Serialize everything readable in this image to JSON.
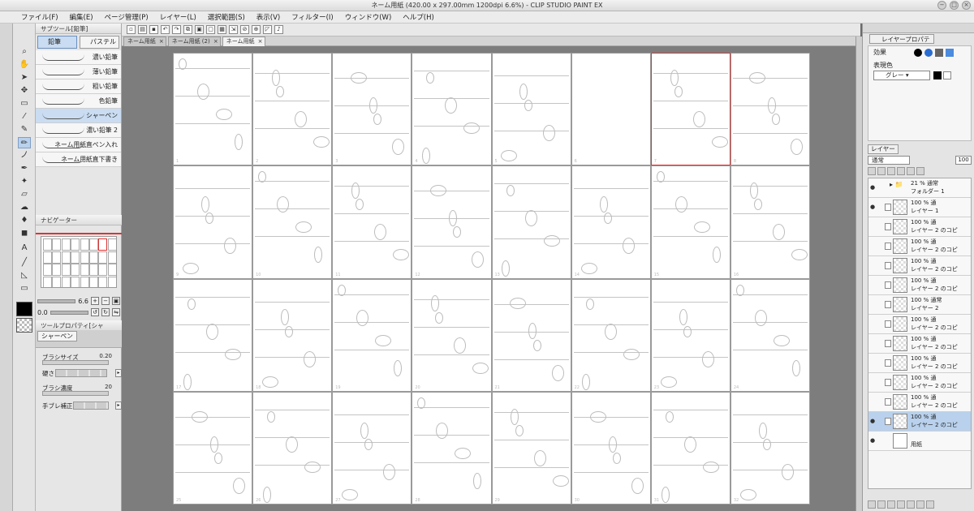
{
  "window": {
    "title": "ネーム用紙 (420.00 x 297.00mm 1200dpi 6.6%) - CLIP STUDIO PAINT EX",
    "minimize": "−",
    "maximize": "□",
    "close": "×"
  },
  "menu": [
    "ファイル(F)",
    "編集(E)",
    "ページ管理(P)",
    "レイヤー(L)",
    "選択範囲(S)",
    "表示(V)",
    "フィルター(I)",
    "ウィンドウ(W)",
    "ヘルプ(H)"
  ],
  "subtool": {
    "header": "サブツール[鉛筆]",
    "tabs": [
      "鉛筆",
      "パステル"
    ],
    "items": [
      "濃い鉛筆",
      "薄い鉛筆",
      "粗い鉛筆",
      "色鉛筆",
      "シャーペン",
      "濃い鉛筆 2",
      "ネーム用紙直ペン入れ",
      "ネーム用紙直下書き"
    ],
    "selected_index": 4
  },
  "navigator": {
    "header": "ナビゲーター",
    "zoom": "6.6",
    "rotation": "0.0"
  },
  "tool_property": {
    "header": "ツールプロパティ[シャ",
    "tool_name": "シャーペン",
    "brush_size_label": "ブラシサイズ",
    "brush_size_value": "0.20",
    "hardness_label": "硬さ",
    "density_label": "ブラシ濃度",
    "density_value": "20",
    "stabilization_label": "手ブレ補正"
  },
  "doc_tabs": [
    "ネーム用紙",
    "ネーム用紙 (2)",
    "ネーム用紙"
  ],
  "page_numbers": [
    "1",
    "2",
    "3",
    "4",
    "5",
    "6",
    "7",
    "8",
    "9",
    "10",
    "11",
    "12",
    "13",
    "14",
    "15",
    "16",
    "17",
    "18",
    "19",
    "20",
    "21",
    "22",
    "23",
    "24",
    "25",
    "26",
    "27",
    "28",
    "29",
    "30",
    "31",
    "32"
  ],
  "layer_property": {
    "header": "レイヤープロパティ",
    "effect_label": "効果",
    "color_label": "表現色",
    "color_value": "グレー"
  },
  "layers_panel": {
    "tab": "レイヤー",
    "blend_mode": "通常",
    "opacity": "100",
    "layers": [
      {
        "top": "21 % 通常",
        "name": "フォルダー 1",
        "type": "folder"
      },
      {
        "top": "100 % 通",
        "name": "レイヤー 1",
        "type": "raster"
      },
      {
        "top": "100 % 通",
        "name": "レイヤー 2 のコピ",
        "type": "raster"
      },
      {
        "top": "100 % 通",
        "name": "レイヤー 2 のコピ",
        "type": "raster"
      },
      {
        "top": "100 % 通",
        "name": "レイヤー 2 のコピ",
        "type": "raster"
      },
      {
        "top": "100 % 通",
        "name": "レイヤー 2 のコピ",
        "type": "raster"
      },
      {
        "top": "100 % 通常",
        "name": "レイヤー 2",
        "type": "raster"
      },
      {
        "top": "100 % 通",
        "name": "レイヤー 2 のコピ",
        "type": "raster"
      },
      {
        "top": "100 % 通",
        "name": "レイヤー 2 のコピ",
        "type": "raster"
      },
      {
        "top": "100 % 通",
        "name": "レイヤー 2 のコピ",
        "type": "raster"
      },
      {
        "top": "100 % 通",
        "name": "レイヤー 2 のコピ",
        "type": "raster"
      },
      {
        "top": "100 % 通",
        "name": "レイヤー 2 のコピ",
        "type": "raster"
      },
      {
        "top": "100 % 通",
        "name": "レイヤー 2 のコピ",
        "type": "raster"
      },
      {
        "top": "",
        "name": "用紙",
        "type": "paper"
      }
    ],
    "selected_index": 12
  },
  "colors": {
    "accent": "#b9d1ec",
    "highlight_page": "#d63b3b"
  }
}
